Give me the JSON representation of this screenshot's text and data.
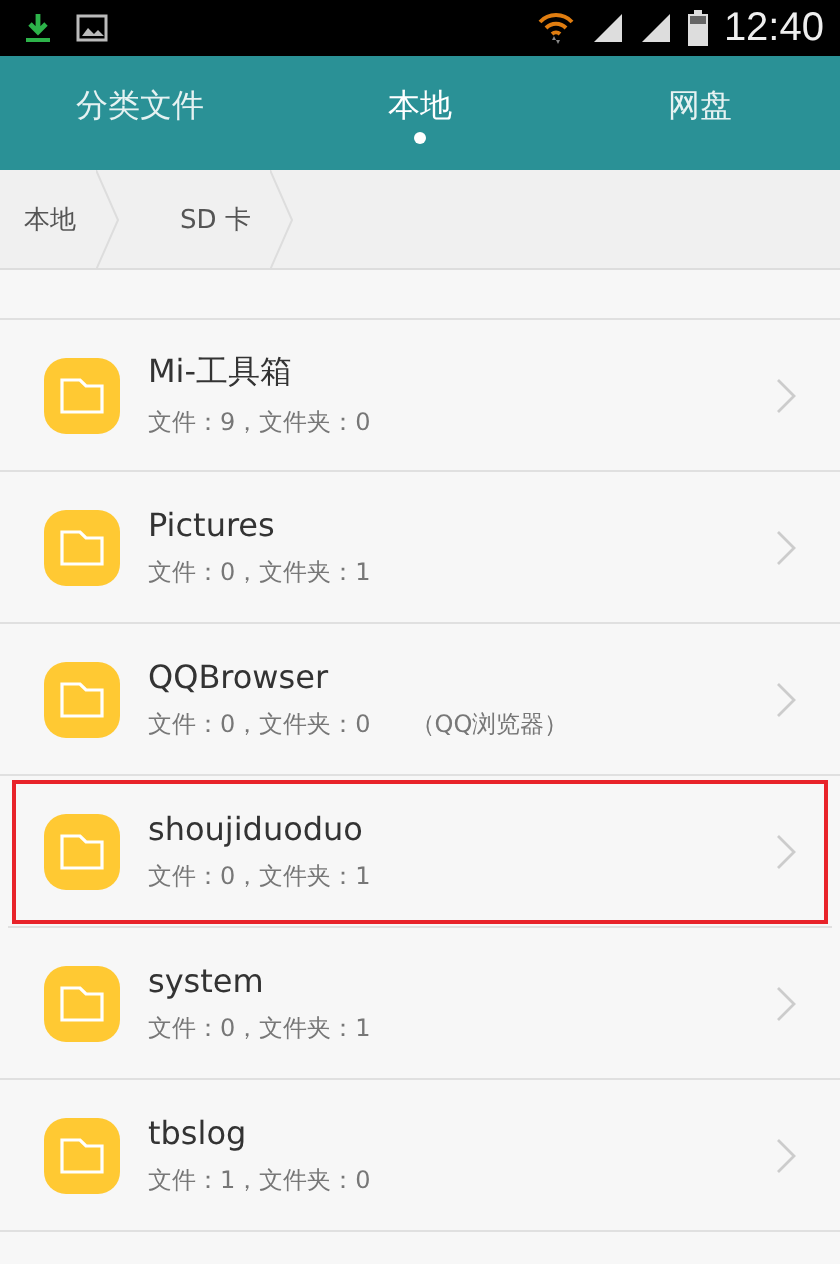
{
  "status_bar": {
    "time": "12:40"
  },
  "tabs": [
    {
      "label": "分类文件",
      "selected": false
    },
    {
      "label": "本地",
      "selected": true
    },
    {
      "label": "网盘",
      "selected": false
    }
  ],
  "breadcrumb": [
    "本地",
    "SD 卡"
  ],
  "folders": [
    {
      "name": "Mi-工具箱",
      "info": "文件：9，文件夹：0",
      "highlighted": false
    },
    {
      "name": "Pictures",
      "info": "文件：0，文件夹：1",
      "highlighted": false
    },
    {
      "name": "QQBrowser",
      "info": "文件：0，文件夹：0",
      "note": "（QQ浏览器）",
      "highlighted": false
    },
    {
      "name": "shoujiduoduo",
      "info": "文件：0，文件夹：1",
      "highlighted": true
    },
    {
      "name": "system",
      "info": "文件：0，文件夹：1",
      "highlighted": false
    },
    {
      "name": "tbslog",
      "info": "文件：1，文件夹：0",
      "highlighted": false
    }
  ]
}
